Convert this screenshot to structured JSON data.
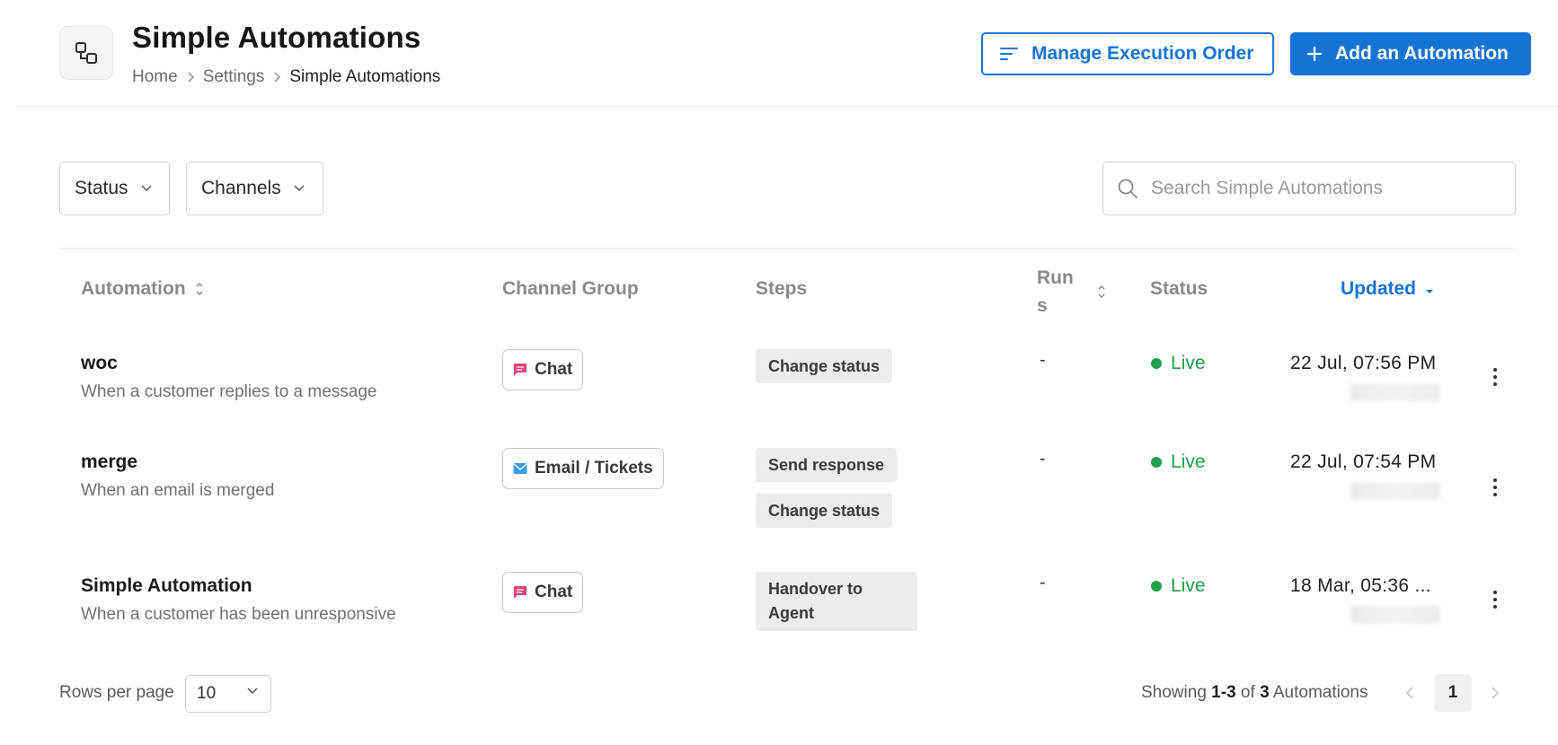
{
  "header": {
    "title": "Simple Automations",
    "breadcrumb": [
      "Home",
      "Settings",
      "Simple Automations"
    ],
    "manage_button": "Manage Execution Order",
    "add_button": "Add an Automation",
    "accent_color": "#1673d6"
  },
  "filters": {
    "status_label": "Status",
    "channels_label": "Channels",
    "search_placeholder": "Search Simple Automations"
  },
  "table": {
    "columns": {
      "automation": "Automation",
      "channel_group": "Channel Group",
      "steps": "Steps",
      "runs_line1": "Run",
      "runs_line2": "s",
      "status": "Status",
      "updated": "Updated"
    },
    "rows": [
      {
        "name": "woc",
        "description": "When a customer replies to a message",
        "channel": "Chat",
        "channel_icon": "chat-icon",
        "steps": [
          "Change status"
        ],
        "runs": "-",
        "status": "Live",
        "updated": "22 Jul, 07:56 PM"
      },
      {
        "name": "merge",
        "description": "When an email is merged",
        "channel": "Email / Tickets",
        "channel_icon": "email-icon",
        "steps": [
          "Send response",
          "Change status"
        ],
        "runs": "-",
        "status": "Live",
        "updated": "22 Jul, 07:54 PM"
      },
      {
        "name": "Simple Automation",
        "description": "When a customer has been unresponsive",
        "channel": "Chat",
        "channel_icon": "chat-icon",
        "steps": [
          "Handover to",
          "Agent"
        ],
        "runs": "-",
        "status": "Live",
        "updated": "18 Mar, 05:36 ..."
      }
    ]
  },
  "footer": {
    "rows_per_page_label": "Rows per page",
    "rows_per_page_value": "10",
    "showing_prefix": "Showing",
    "showing_range": "1-3",
    "showing_of": "of",
    "showing_total": "3",
    "showing_suffix": "Automations",
    "current_page": "1"
  }
}
